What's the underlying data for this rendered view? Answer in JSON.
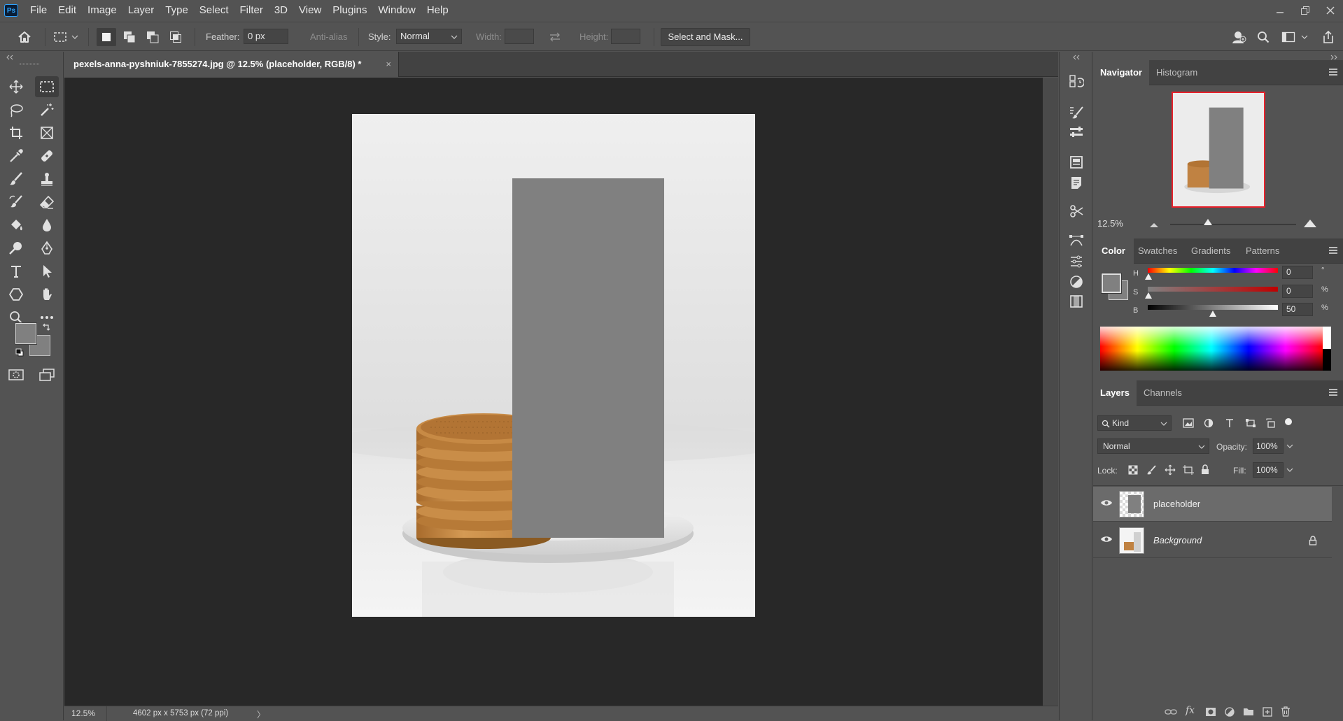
{
  "menubar": {
    "logo": "Ps",
    "items": [
      "File",
      "Edit",
      "Image",
      "Layer",
      "Type",
      "Select",
      "Filter",
      "3D",
      "View",
      "Plugins",
      "Window",
      "Help"
    ]
  },
  "options": {
    "feather_label": "Feather:",
    "feather_value": "0 px",
    "antialias_label": "Anti-alias",
    "style_label": "Style:",
    "style_value": "Normal",
    "width_label": "Width:",
    "height_label": "Height:",
    "select_mask_label": "Select and Mask..."
  },
  "document": {
    "tab_title": "pexels-anna-pyshniuk-7855274.jpg @ 12.5% (placeholder, RGB/8) *",
    "close_glyph": "×"
  },
  "status": {
    "zoom": "12.5%",
    "doc_info": "4602 px x 5753 px (72 ppi)",
    "arrow": "〉"
  },
  "navigator": {
    "tabs": [
      "Navigator",
      "Histogram"
    ],
    "zoom": "12.5%",
    "zoom_slider_fraction": 0.3
  },
  "color": {
    "tabs": [
      "Color",
      "Swatches",
      "Gradients",
      "Patterns"
    ],
    "h_label": "H",
    "h_value": "0",
    "h_unit": "°",
    "s_label": "S",
    "s_value": "0",
    "s_unit": "%",
    "b_label": "B",
    "b_value": "50",
    "b_unit": "%",
    "foreground": "#808080",
    "background": "#808080"
  },
  "layers": {
    "tabs": [
      "Layers",
      "Channels"
    ],
    "kind_label": "Kind",
    "blend_mode": "Normal",
    "opacity_label": "Opacity:",
    "opacity_value": "100%",
    "lock_label": "Lock:",
    "fill_label": "Fill:",
    "fill_value": "100%",
    "items": [
      {
        "name": "placeholder",
        "selected": true,
        "locked": false
      },
      {
        "name": "Background",
        "selected": false,
        "locked": true
      }
    ]
  },
  "colors": {
    "placeholder_fill": "#808080",
    "accent": "#31a8ff"
  }
}
